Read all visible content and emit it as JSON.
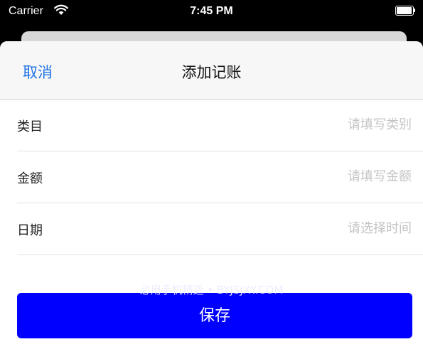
{
  "status_bar": {
    "carrier": "Carrier",
    "time": "7:45 PM",
    "wifi_icon": "wifi-icon",
    "battery_icon": "battery-icon",
    "battery_level": 1.0
  },
  "nav": {
    "cancel_label": "取消",
    "title": "添加记账"
  },
  "form": {
    "rows": [
      {
        "label": "类目",
        "placeholder": "请填写类别",
        "value": ""
      },
      {
        "label": "金额",
        "placeholder": "请填写金额",
        "value": ""
      },
      {
        "label": "日期",
        "placeholder": "请选择时间",
        "value": ""
      }
    ]
  },
  "save_button": {
    "label": "保存"
  },
  "watermark": "必用手机精选 • BYJSJXY.COM",
  "colors": {
    "accent": "#1f74e6",
    "primary_button": "#0000ff",
    "placeholder": "#c4c4c4",
    "nav_background": "#f7f7f7"
  }
}
